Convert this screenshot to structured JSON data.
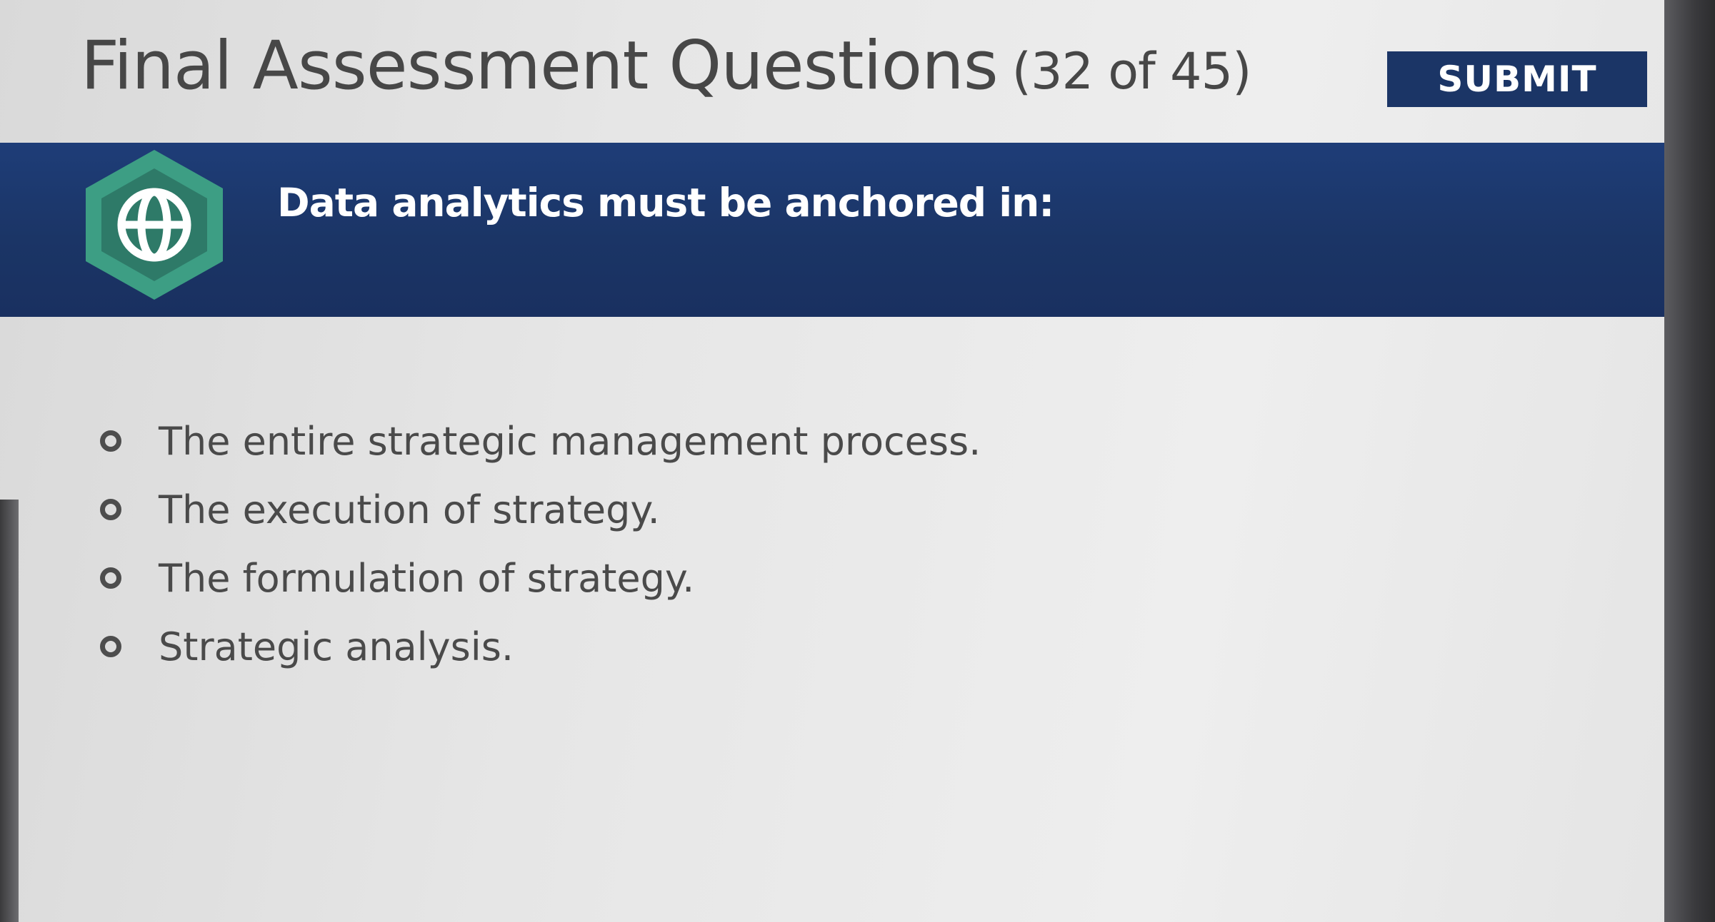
{
  "header": {
    "title": "Final Assessment Questions",
    "progress": "(32 of 45)",
    "submit_label": "SUBMIT"
  },
  "question": {
    "text": "Data analytics must be anchored in:",
    "badge_icon": "globe-icon"
  },
  "options": [
    {
      "label": "The entire strategic management process.",
      "selected": false
    },
    {
      "label": "The execution of strategy.",
      "selected": false
    },
    {
      "label": "The formulation of strategy.",
      "selected": false
    },
    {
      "label": "Strategic analysis.",
      "selected": false
    }
  ],
  "colors": {
    "band": "#1b3566",
    "submit_bg": "#1b3566",
    "badge_outer": "#3d9e84",
    "badge_inner": "#2e7a68",
    "text": "#4a4a4a"
  }
}
